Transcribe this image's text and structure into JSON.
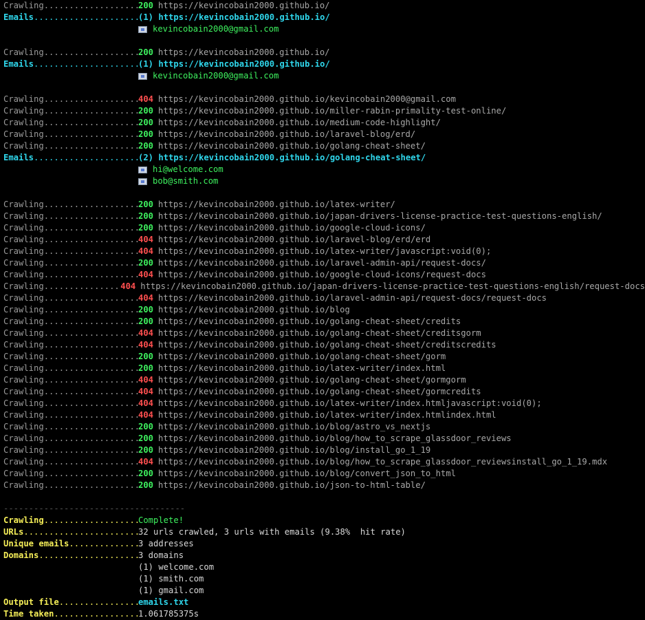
{
  "blocks": [
    {
      "type": "crawl",
      "status": "200",
      "url": "https://kevincobain2000.github.io/"
    },
    {
      "type": "emails",
      "label": "(1) https://kevincobain2000.github.io/",
      "addresses": [
        "kevincobain2000@gmail.com"
      ]
    },
    {
      "type": "blank"
    },
    {
      "type": "crawl",
      "status": "200",
      "url": "https://kevincobain2000.github.io/"
    },
    {
      "type": "emails",
      "label": "(1) https://kevincobain2000.github.io/",
      "addresses": [
        "kevincobain2000@gmail.com"
      ]
    },
    {
      "type": "blank"
    },
    {
      "type": "crawl",
      "status": "404",
      "url": "https://kevincobain2000.github.io/kevincobain2000@gmail.com"
    },
    {
      "type": "crawl",
      "status": "200",
      "url": "https://kevincobain2000.github.io/miller-rabin-primality-test-online/"
    },
    {
      "type": "crawl",
      "status": "200",
      "url": "https://kevincobain2000.github.io/medium-code-highlight/"
    },
    {
      "type": "crawl",
      "status": "200",
      "url": "https://kevincobain2000.github.io/laravel-blog/erd/"
    },
    {
      "type": "crawl",
      "status": "200",
      "url": "https://kevincobain2000.github.io/golang-cheat-sheet/"
    },
    {
      "type": "emails",
      "label": "(2) https://kevincobain2000.github.io/golang-cheat-sheet/",
      "addresses": [
        "hi@welcome.com",
        "bob@smith.com"
      ]
    },
    {
      "type": "blank"
    },
    {
      "type": "crawl",
      "status": "200",
      "url": "https://kevincobain2000.github.io/latex-writer/"
    },
    {
      "type": "crawl",
      "status": "200",
      "url": "https://kevincobain2000.github.io/japan-drivers-license-practice-test-questions-english/"
    },
    {
      "type": "crawl",
      "status": "200",
      "url": "https://kevincobain2000.github.io/google-cloud-icons/"
    },
    {
      "type": "crawl",
      "status": "404",
      "url": "https://kevincobain2000.github.io/laravel-blog/erd/erd"
    },
    {
      "type": "crawl",
      "status": "404",
      "url": "https://kevincobain2000.github.io/latex-writer/javascript:void(0);"
    },
    {
      "type": "crawl",
      "status": "200",
      "url": "https://kevincobain2000.github.io/laravel-admin-api/request-docs/"
    },
    {
      "type": "crawl",
      "status": "404",
      "url": "https://kevincobain2000.github.io/google-cloud-icons/request-docs"
    },
    {
      "type": "crawl",
      "status": "404",
      "url": "https://kevincobain2000.github.io/japan-drivers-license-practice-test-questions-english/request-docs"
    },
    {
      "type": "crawl",
      "status": "404",
      "url": "https://kevincobain2000.github.io/laravel-admin-api/request-docs/request-docs"
    },
    {
      "type": "crawl",
      "status": "200",
      "url": "https://kevincobain2000.github.io/blog"
    },
    {
      "type": "crawl",
      "status": "200",
      "url": "https://kevincobain2000.github.io/golang-cheat-sheet/credits"
    },
    {
      "type": "crawl",
      "status": "404",
      "url": "https://kevincobain2000.github.io/golang-cheat-sheet/creditsgorm"
    },
    {
      "type": "crawl",
      "status": "404",
      "url": "https://kevincobain2000.github.io/golang-cheat-sheet/creditscredits"
    },
    {
      "type": "crawl",
      "status": "200",
      "url": "https://kevincobain2000.github.io/golang-cheat-sheet/gorm"
    },
    {
      "type": "crawl",
      "status": "200",
      "url": "https://kevincobain2000.github.io/latex-writer/index.html"
    },
    {
      "type": "crawl",
      "status": "404",
      "url": "https://kevincobain2000.github.io/golang-cheat-sheet/gormgorm"
    },
    {
      "type": "crawl",
      "status": "404",
      "url": "https://kevincobain2000.github.io/golang-cheat-sheet/gormcredits"
    },
    {
      "type": "crawl",
      "status": "404",
      "url": "https://kevincobain2000.github.io/latex-writer/index.htmljavascript:void(0);"
    },
    {
      "type": "crawl",
      "status": "404",
      "url": "https://kevincobain2000.github.io/latex-writer/index.htmlindex.html"
    },
    {
      "type": "crawl",
      "status": "200",
      "url": "https://kevincobain2000.github.io/blog/astro_vs_nextjs"
    },
    {
      "type": "crawl",
      "status": "200",
      "url": "https://kevincobain2000.github.io/blog/how_to_scrape_glassdoor_reviews"
    },
    {
      "type": "crawl",
      "status": "200",
      "url": "https://kevincobain2000.github.io/blog/install_go_1_19"
    },
    {
      "type": "crawl",
      "status": "404",
      "url": "https://kevincobain2000.github.io/blog/how_to_scrape_glassdoor_reviewsinstall_go_1_19.mdx"
    },
    {
      "type": "crawl",
      "status": "200",
      "url": "https://kevincobain2000.github.io/blog/convert_json_to_html"
    },
    {
      "type": "crawl",
      "status": "200",
      "url": "https://kevincobain2000.github.io/json-to-html-table/"
    },
    {
      "type": "blank"
    }
  ],
  "labels": {
    "crawling": "Crawling",
    "emails": "Emails",
    "separator": "------------------------------------"
  },
  "summary": {
    "crawling_label": "Crawling",
    "crawling_value": "Complete!",
    "urls_label": "URLs",
    "urls_value": "32 urls crawled, 3 urls with emails (9.38%  hit rate)",
    "unique_label": "Unique emails",
    "unique_value": "3 addresses",
    "domains_label": "Domains",
    "domains_value": "3 domains",
    "domain_list": [
      "(1) welcome.com",
      "(1) smith.com",
      "(1) gmail.com"
    ],
    "output_label": "Output file",
    "output_value": "emails.txt",
    "time_label": "Time taken",
    "time_value": "1.061785375s"
  },
  "colors": {
    "status_ok": "#3ef25f",
    "status_not_found": "#ff4f4f",
    "emails_header": "#2fd7ec",
    "summary_label": "#f5ee58"
  },
  "icons": {
    "email_item": "envelope-icon"
  }
}
